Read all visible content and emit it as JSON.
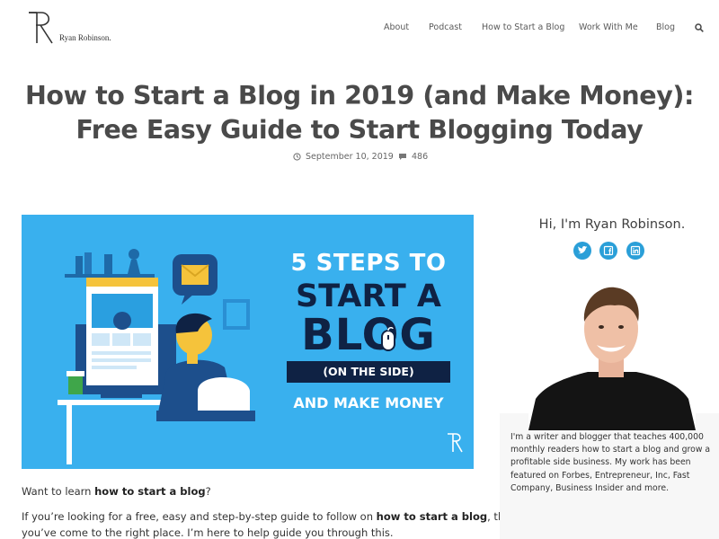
{
  "brand": {
    "name": "Ryan Robinson."
  },
  "nav": {
    "items": [
      {
        "label": "About"
      },
      {
        "label": "Podcast"
      },
      {
        "label": "How to Start a Blog"
      },
      {
        "label": "Work With Me"
      },
      {
        "label": "Blog"
      }
    ],
    "search_icon": "search-icon"
  },
  "article": {
    "title_line1": "How to Start a Blog in 2019 (and Make Money):",
    "title_line2": "Free Easy Guide to Start Blogging Today",
    "date": "September 10, 2019",
    "comments": "486",
    "hero": {
      "line1": "5 STEPS TO",
      "line2": "START A",
      "line3": "BLOG",
      "line4": "(ON THE SIDE)",
      "line5": "AND MAKE MONEY",
      "bg_color": "#39b0ee",
      "dark_color": "#0f2244"
    },
    "para1_pre": "Want to learn ",
    "para1_bold": "how to start a blog",
    "para1_post": "?",
    "para2_pre": "If you’re looking for a free, easy and step-by-step guide to follow on ",
    "para2_bold": "how to start a blog",
    "para2_post": ", then",
    "para3": "you’ve come to the right place. I’m here to help guide you through this."
  },
  "sidebar": {
    "greeting": "Hi, I'm Ryan Robinson.",
    "socials": [
      "twitter-icon",
      "facebook-icon",
      "linkedin-icon"
    ],
    "bio_lines": [
      "I'm a writer and blogger that teaches 400,000",
      "monthly readers how to start a blog and grow a",
      "profitable side business. My work has been",
      "featured on Forbes, Entrepreneur, Inc, Fast",
      "Company, Business Insider and more."
    ],
    "accent_color": "#2a9fd8"
  }
}
